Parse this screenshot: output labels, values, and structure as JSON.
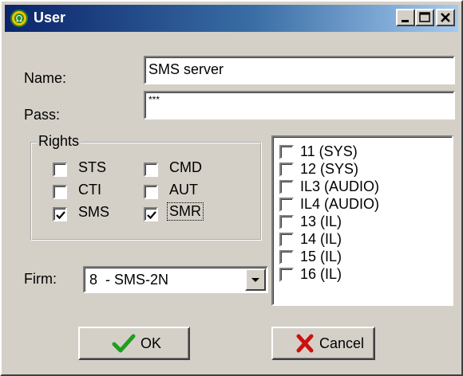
{
  "window": {
    "title": "User",
    "title_icon": "omega-circle-icon",
    "controls": [
      "minimize",
      "maximize",
      "close"
    ]
  },
  "form": {
    "name_label": "Name:",
    "name_value": "SMS server",
    "pass_label": "Pass:",
    "pass_value": "***",
    "firm_label": "Firm:",
    "firm_value": "8  - SMS-2N"
  },
  "rights": {
    "title": "Rights",
    "items": [
      {
        "label": "STS",
        "checked": false
      },
      {
        "label": "CMD",
        "checked": false
      },
      {
        "label": "CTI",
        "checked": false
      },
      {
        "label": "AUT",
        "checked": false
      },
      {
        "label": "SMS",
        "checked": true
      },
      {
        "label": "SMR",
        "checked": true,
        "focused": true
      }
    ]
  },
  "channels": [
    {
      "label": "11 (SYS)",
      "checked": false
    },
    {
      "label": "12 (SYS)",
      "checked": false
    },
    {
      "label": "IL3 (AUDIO)",
      "checked": false
    },
    {
      "label": "IL4 (AUDIO)",
      "checked": false
    },
    {
      "label": "13 (IL)",
      "checked": false
    },
    {
      "label": "14 (IL)",
      "checked": false
    },
    {
      "label": "15 (IL)",
      "checked": false
    },
    {
      "label": "16 (IL)",
      "checked": false
    }
  ],
  "buttons": {
    "ok_label": "OK",
    "ok_icon": "checkmark-icon",
    "cancel_label": "Cancel",
    "cancel_icon": "x-mark-icon"
  },
  "colors": {
    "titlebar_start": "#0a246a",
    "titlebar_end": "#a6caf0",
    "face": "#d4d0c8",
    "ok_check": "#1e9e1e",
    "cancel_x": "#cc1010"
  }
}
